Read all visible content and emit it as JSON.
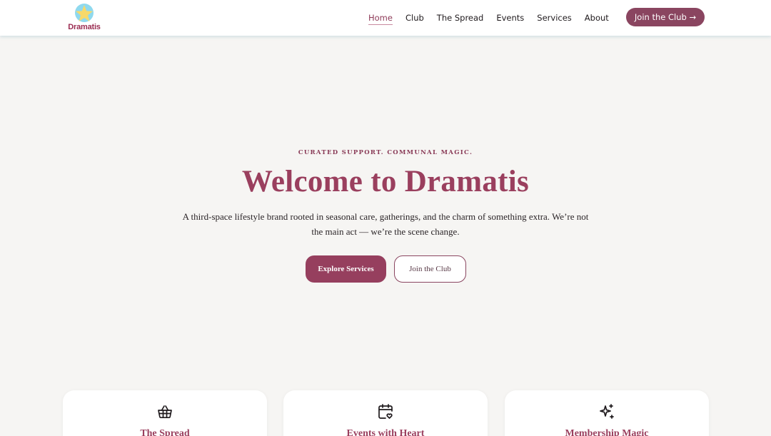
{
  "brand": {
    "name": "Dramatis",
    "accent": "#9a3f5e",
    "button_color": "#8a4560",
    "background": "#f6f5f3"
  },
  "nav": {
    "items": [
      {
        "label": "Home",
        "active": true
      },
      {
        "label": "Club",
        "active": false
      },
      {
        "label": "The Spread",
        "active": false
      },
      {
        "label": "Events",
        "active": false
      },
      {
        "label": "Services",
        "active": false
      },
      {
        "label": "About",
        "active": false
      }
    ],
    "cta_label": "Join the Club →"
  },
  "hero": {
    "eyebrow": "CURATED SUPPORT. COMMUNAL MAGIC.",
    "title": "Welcome to Dramatis",
    "description": "A third-space lifestyle brand rooted in seasonal care, gatherings, and the charm of something extra. We’re not the main act — we’re the scene change.",
    "primary_button": "Explore Services",
    "secondary_button": "Join the Club"
  },
  "cards": [
    {
      "title": "The Spread",
      "icon": "basket-icon"
    },
    {
      "title": "Events with Heart",
      "icon": "calendar-heart-icon"
    },
    {
      "title": "Membership Magic",
      "icon": "sparkles-icon"
    }
  ]
}
